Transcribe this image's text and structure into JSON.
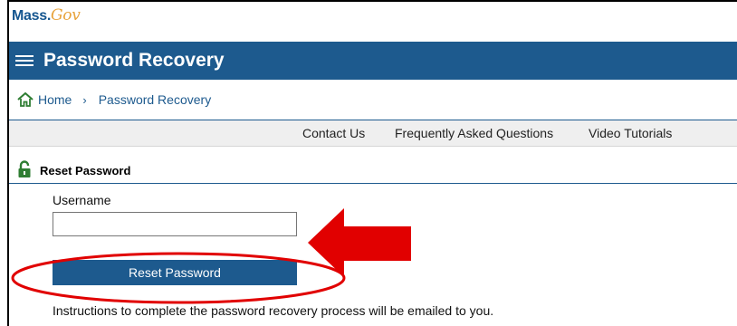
{
  "logo": {
    "text_mass": "Mass.",
    "text_gov": "Gov"
  },
  "header": {
    "title": "Password Recovery"
  },
  "breadcrumb": {
    "home": "Home",
    "separator": "›",
    "current": "Password Recovery"
  },
  "nav": {
    "items": [
      "Contact Us",
      "Frequently Asked Questions",
      "Video Tutorials"
    ]
  },
  "section": {
    "title": "Reset Password"
  },
  "form": {
    "username_label": "Username",
    "username_value": "",
    "username_placeholder": "",
    "submit_label": "Reset Password",
    "instructions": "Instructions to complete the password recovery process will be emailed to you."
  },
  "colors": {
    "brand_blue": "#1d5a8e",
    "lock_green": "#2e7d32",
    "annotation_red": "#e10000"
  },
  "icons": {
    "menu": "hamburger-icon",
    "home": "home-icon",
    "lock": "lock-icon"
  }
}
